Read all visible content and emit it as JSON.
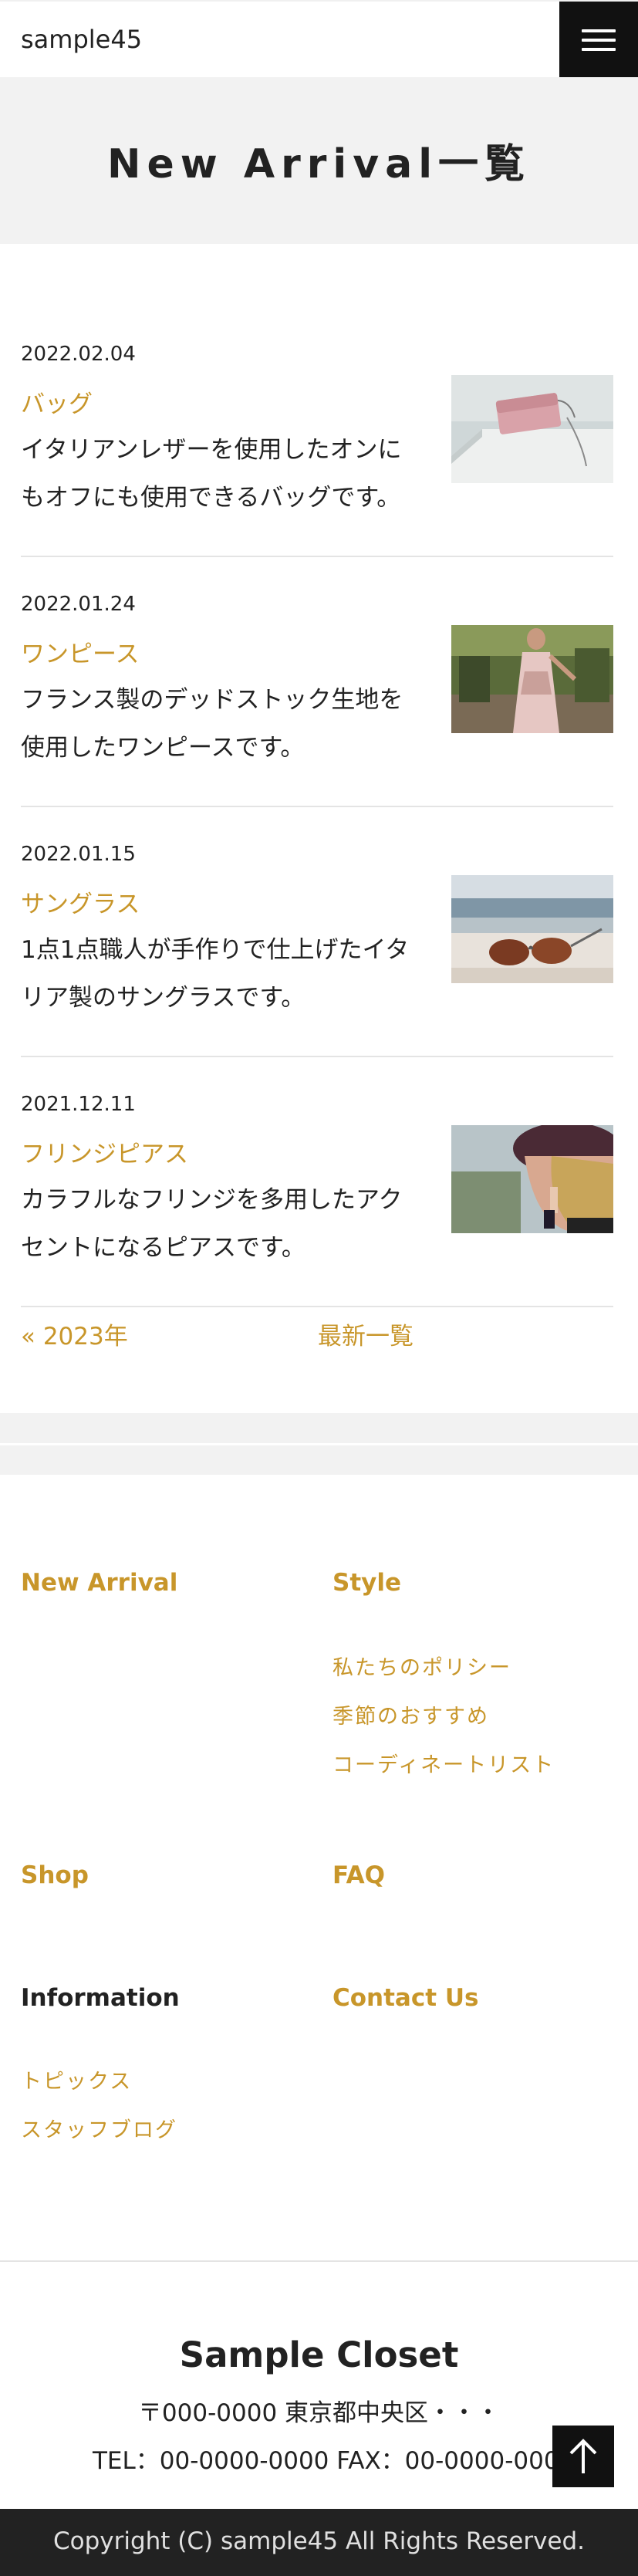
{
  "header": {
    "site_name": "sample45",
    "menu_icon": "hamburger-menu-icon"
  },
  "page": {
    "title": "New Arrival一覧"
  },
  "articles": [
    {
      "date": "2022.02.04",
      "category": "バッグ",
      "description": "イタリアンレザーを使用したオンにもオフにも使用できるバッグです。",
      "image": "pink-handbag-photo"
    },
    {
      "date": "2022.01.24",
      "category": "ワンピース",
      "description": "フランス製のデッドストック生地を使用したワンピースです。",
      "image": "floral-dress-photo"
    },
    {
      "date": "2022.01.15",
      "category": "サングラス",
      "description": "1点1点職人が手作りで仕上げたイタリア製のサングラスです。",
      "image": "sunglasses-photo"
    },
    {
      "date": "2021.12.11",
      "category": "フリンジピアス",
      "description": "カラフルなフリンジを多用したアクセントになるピアスです。",
      "image": "fringe-earring-photo"
    }
  ],
  "pager": {
    "prev_label": "« 2023年",
    "latest_label": "最新一覧"
  },
  "footer_nav": {
    "new_arrival": "New Arrival",
    "style": "Style",
    "style_links": [
      "私たちのポリシー",
      "季節のおすすめ",
      "コーディネートリスト"
    ],
    "shop": "Shop",
    "faq": "FAQ",
    "information": "Information",
    "information_links": [
      "トピックス",
      "スタッフブログ"
    ],
    "contact": "Contact Us"
  },
  "company": {
    "name": "Sample Closet",
    "address": "〒000-0000 東京都中央区・・・",
    "tel": "TEL：00-0000-0000 FAX：00-0000-0000"
  },
  "page_top_icon": "arrow-up-icon",
  "copyright": "Copyright (C) sample45 All Rights Reserved.",
  "colors": {
    "accent": "#c8962a",
    "dark": "#111111",
    "band": "#f2f2f2"
  }
}
